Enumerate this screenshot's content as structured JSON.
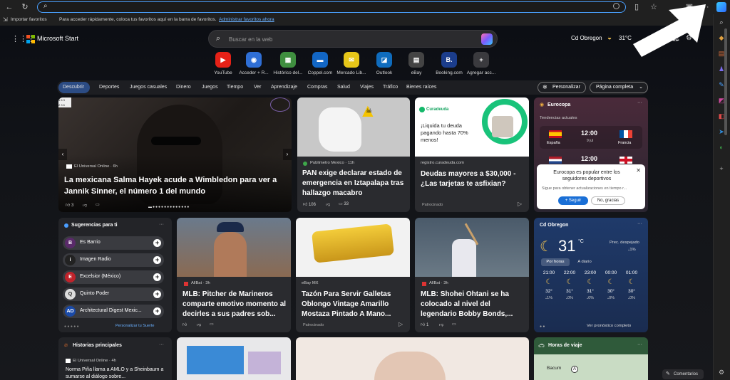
{
  "favorites": {
    "import": "Importar favoritos",
    "hint": "Para acceder rápidamente, coloca tus favoritos aquí en la barra de favoritos.",
    "link": "Administrar favoritos ahora"
  },
  "brand": "Microsoft Start",
  "search": {
    "placeholder": "Buscar en la web"
  },
  "weather_header": {
    "city": "Cd Obregon",
    "temp": "31°C"
  },
  "tiles": [
    {
      "label": "YouTube",
      "color": "#e62117",
      "glyph": "▶"
    },
    {
      "label": "Acceder + R...",
      "color": "#2f6fd6",
      "glyph": "◉"
    },
    {
      "label": "Histórico del...",
      "color": "#3f8f3f",
      "glyph": "▦"
    },
    {
      "label": "Coppel.com",
      "color": "#1266c4",
      "glyph": "▬"
    },
    {
      "label": "Mercado Lib...",
      "color": "#e6c619",
      "glyph": "✉"
    },
    {
      "label": "Outlook",
      "color": "#0f6cbd",
      "glyph": "◪"
    },
    {
      "label": "eBay",
      "color": "#444",
      "glyph": "▤"
    },
    {
      "label": "Booking.com",
      "color": "#1b3d8c",
      "glyph": "B."
    },
    {
      "label": "Agregar acc...",
      "color": "#3a3a3e",
      "glyph": "+"
    }
  ],
  "nav": [
    "Descubrir",
    "Deportes",
    "Juegos casuales",
    "Dinero",
    "Juegos",
    "Tiempo",
    "Ver",
    "Aprendizaje",
    "Compras",
    "Salud",
    "Viajes",
    "Tráfico",
    "Bienes raíces"
  ],
  "nav_right": {
    "personalize": "Personalizar",
    "layout": "Página completa"
  },
  "hero": {
    "source": "El Universal Online · 6h",
    "title": "La mexicana Salma Hayek acude a Wimbledon para ver a Jannik Sinner, el número 1 del mundo",
    "likes": "3"
  },
  "card_pan": {
    "source": "Publimetro Mexico · 11h",
    "title": "PAN exige declarar estado de emergencia en Iztapalapa tras hallazgo macabro",
    "likes": "106",
    "comments": "33"
  },
  "ad_cura": {
    "brand": "Curadeuda",
    "headline": "¡Liquida tu deuda pagando hasta 70% menos!",
    "domain": "registro.curadeuda.com",
    "title": "Deudas mayores a $30,000 - ¿Las tarjetas te asfixian?",
    "sponsored": "Patrocinado"
  },
  "euro": {
    "label": "Eurocopa",
    "trends": "Tendencias actuales",
    "team1": "España",
    "team2": "Francia",
    "time1": "12:00",
    "day1": "9 jul",
    "time2": "12:00",
    "popup_text": "Eurocopa es popular entre los seguidores deportivos",
    "popup_sub": "Sigue para obtener actualizaciones en tiempo r...",
    "follow": "Seguir",
    "no": "No, gracias"
  },
  "suggestions": {
    "title": "Sugerencias para ti",
    "items": [
      {
        "name": "Es Barrio",
        "color": "#5a2a6a",
        "glyph": "B"
      },
      {
        "name": "Imagen Radio",
        "color": "#222",
        "glyph": "i"
      },
      {
        "name": "Excelsior (México)",
        "color": "#c0232b",
        "glyph": "E"
      },
      {
        "name": "Quinto Poder",
        "color": "#ddd",
        "glyph": "Q"
      },
      {
        "name": "Architectural Digest Mexic...",
        "color": "#1a4aa8",
        "glyph": "AD"
      }
    ],
    "customize": "Personalizar tu Suerte"
  },
  "card_mlb1": {
    "source": "AllBat · 3h",
    "title": "MLB: Pitcher de Marineros comparte emotivo momento al decirles a sus padres sob..."
  },
  "card_ebay": {
    "source": "eBay MX",
    "title": "Tazón Para Servir Galletas Oblongo Vintage Amarillo Mostaza Pintado A Mano...",
    "sponsored": "Patrocinado"
  },
  "card_mlb2": {
    "source": "AllBat · 3h",
    "title": "MLB: Shohei Ohtani se ha colocado al nivel del legendario Bobby Bonds,...",
    "likes": "1"
  },
  "weather": {
    "city": "Cd Obregon",
    "temp": "31",
    "unit": "°C",
    "desc": "Prec. despejado",
    "precip": "1%",
    "tab1": "Por horas",
    "tab2": "A diario",
    "more": "Ver pronóstico completo",
    "hours": [
      {
        "t": "21:00",
        "v": "32°",
        "p": "1%"
      },
      {
        "t": "22:00",
        "v": "31°",
        "p": "0%"
      },
      {
        "t": "23:00",
        "v": "31°",
        "p": "0%"
      },
      {
        "t": "00:00",
        "v": "30°",
        "p": "0%"
      },
      {
        "t": "01:00",
        "v": "30°",
        "p": "0%"
      }
    ]
  },
  "historias": {
    "title": "Historias principales",
    "source": "El Universal Online · 4h",
    "text": "Norma Piña llama a AMLO y a Sheinbaum a sumarse al diálogo sobre..."
  },
  "travel": {
    "title": "Horas de viaje",
    "place": "Bacum"
  },
  "feedback": "Comentarios"
}
